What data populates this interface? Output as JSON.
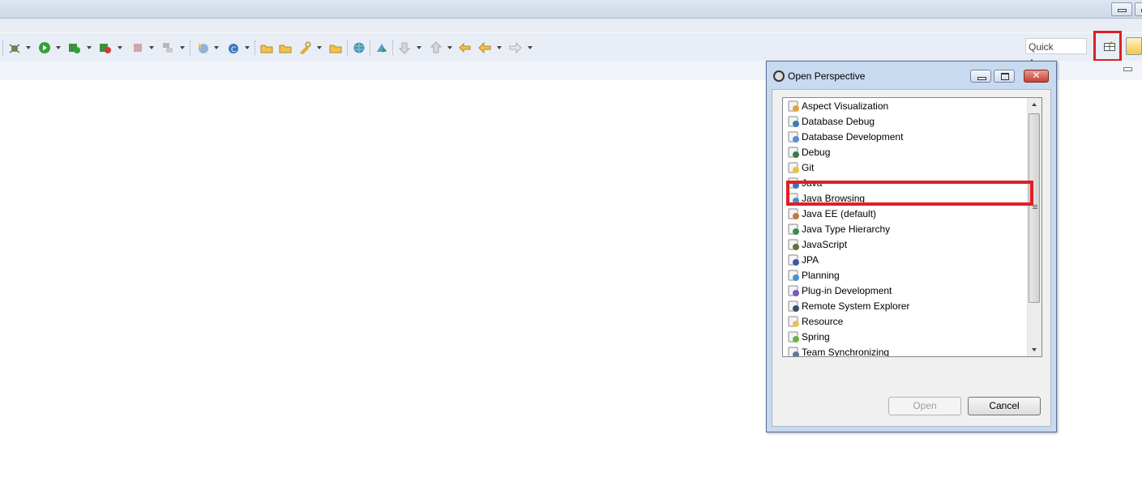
{
  "toolbar": {
    "quick_access": "Quick Access"
  },
  "dialog": {
    "title": "Open Perspective",
    "items": [
      {
        "label": "Aspect Visualization",
        "icon": "aspect-visualization-icon",
        "color": "#e8a23a"
      },
      {
        "label": "Database Debug",
        "icon": "database-debug-icon",
        "color": "#3a78c2"
      },
      {
        "label": "Database Development",
        "icon": "database-development-icon",
        "color": "#5b8fd0"
      },
      {
        "label": "Debug",
        "icon": "debug-icon",
        "color": "#3d7a3d"
      },
      {
        "label": "Git",
        "icon": "git-icon",
        "color": "#e6c445"
      },
      {
        "label": "Java",
        "icon": "java-icon",
        "color": "#4a6fb5"
      },
      {
        "label": "Java Browsing",
        "icon": "java-browsing-icon",
        "color": "#4a90c2"
      },
      {
        "label": "Java EE (default)",
        "icon": "java-ee-icon",
        "color": "#c27a3a"
      },
      {
        "label": "Java Type Hierarchy",
        "icon": "java-type-hierarchy-icon",
        "color": "#3d8a5a"
      },
      {
        "label": "JavaScript",
        "icon": "javascript-icon",
        "color": "#6b6b3a"
      },
      {
        "label": "JPA",
        "icon": "jpa-icon",
        "color": "#3a5aa0"
      },
      {
        "label": "Planning",
        "icon": "planning-icon",
        "color": "#4a90d0"
      },
      {
        "label": "Plug-in Development",
        "icon": "plugin-development-icon",
        "color": "#7a5ab5"
      },
      {
        "label": "Remote System Explorer",
        "icon": "remote-system-explorer-icon",
        "color": "#3a4a70"
      },
      {
        "label": "Resource",
        "icon": "resource-icon",
        "color": "#e8c060"
      },
      {
        "label": "Spring",
        "icon": "spring-icon",
        "color": "#6db33f"
      },
      {
        "label": "Team Synchronizing",
        "icon": "team-synchronizing-icon",
        "color": "#5a7a9a"
      }
    ],
    "open_label": "Open",
    "cancel_label": "Cancel"
  },
  "colors": {
    "highlight": "#e01e25",
    "toolbar_bg": "#e9eef6",
    "dialog_frame": "#c8daf0"
  }
}
